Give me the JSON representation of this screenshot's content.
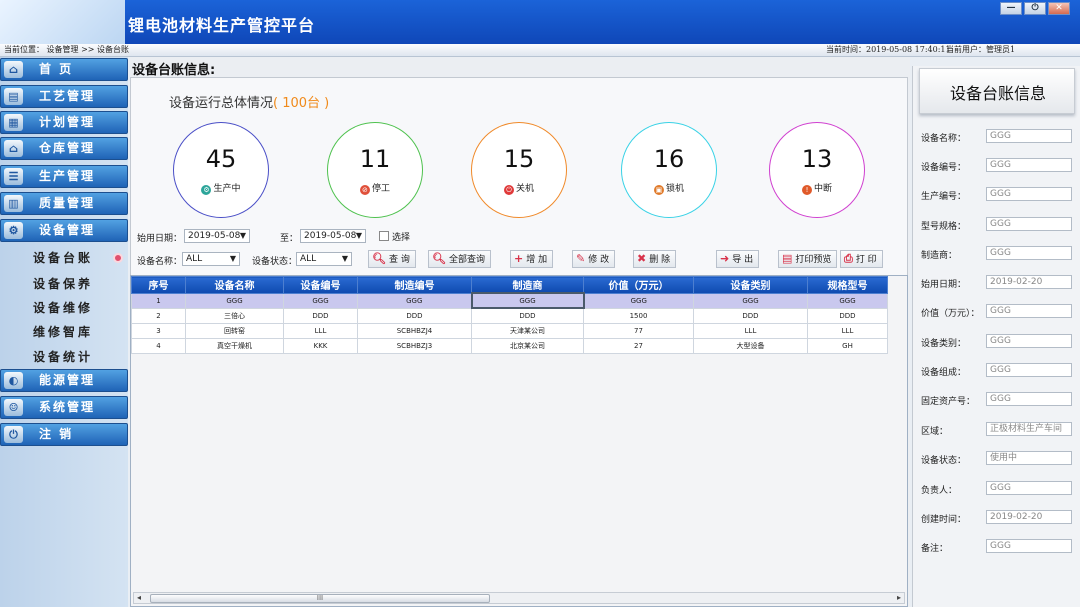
{
  "app": {
    "title": "锂电池材料生产管控平台"
  },
  "window_buttons": {
    "minimize": "—",
    "power": "⏻",
    "close": "✕"
  },
  "status_bar": {
    "location_label": "当前位置：",
    "location_path": "设备管理 >> 设备台账",
    "time_label": "当前时间：",
    "time_value": "2019-05-08 17:40:11",
    "user_label": "当前用户：",
    "user_value": "管理员1"
  },
  "sidebar": {
    "menus": [
      {
        "label": "首 页",
        "icon": "home-icon",
        "glyph": "⌂"
      },
      {
        "label": "工艺管理",
        "icon": "document-icon",
        "glyph": "▤"
      },
      {
        "label": "计划管理",
        "icon": "plan-icon",
        "glyph": "▦"
      },
      {
        "label": "仓库管理",
        "icon": "warehouse-icon",
        "glyph": "⌂"
      },
      {
        "label": "生产管理",
        "icon": "list-icon",
        "glyph": "☰"
      },
      {
        "label": "质量管理",
        "icon": "chart-icon",
        "glyph": "▥"
      },
      {
        "label": "设备管理",
        "icon": "gear-icon",
        "glyph": "⚙"
      },
      {
        "label": "能源管理",
        "icon": "energy-icon",
        "glyph": "◐"
      },
      {
        "label": "系统管理",
        "icon": "users-icon",
        "glyph": "☺"
      },
      {
        "label": "注 销",
        "icon": "power-icon",
        "glyph": "⏻"
      }
    ],
    "sub_items": [
      "设备台账",
      "设备保养",
      "设备维修",
      "维修智库",
      "设备统计"
    ]
  },
  "main": {
    "title": "设备台账信息:",
    "summary_title": "设备运行总体情况",
    "summary_count": "( 100台 )",
    "stats": [
      {
        "value": "45",
        "label": "生产中",
        "color": "#4a4fc7",
        "icon": "running-icon",
        "glyph": "⚙",
        "icon_color": "#2ca59a"
      },
      {
        "value": "11",
        "label": "停工",
        "color": "#4fc24f",
        "icon": "stop-icon",
        "glyph": "⊘",
        "icon_color": "#e0503a"
      },
      {
        "value": "15",
        "label": "关机",
        "color": "#f08a2a",
        "icon": "power-off-icon",
        "glyph": "⏻",
        "icon_color": "#e03a3a"
      },
      {
        "value": "16",
        "label": "锁机",
        "color": "#39d2e6",
        "icon": "lock-icon",
        "glyph": "▣",
        "icon_color": "#e07a2a"
      },
      {
        "value": "13",
        "label": "中断",
        "color": "#d040d0",
        "icon": "warning-icon",
        "glyph": "!",
        "icon_color": "#e05a2a"
      }
    ],
    "filters": {
      "start_date_label": "始用日期：",
      "start_date": "2019-05-08",
      "to_label": "至：",
      "end_date": "2019-05-08",
      "select_label": "选择",
      "device_name_label": "设备名称：",
      "device_name": "ALL",
      "device_status_label": "设备状态：",
      "device_status": "ALL"
    },
    "buttons": {
      "query": "查 询",
      "query_all": "全部查询",
      "add": "增 加",
      "edit": "修 改",
      "delete": "删 除",
      "export": "导 出",
      "print_preview": "打印预览",
      "print": "打 印"
    },
    "table": {
      "columns": [
        "序号",
        "设备名称",
        "设备编号",
        "制造编号",
        "制造商",
        "价值（万元）",
        "设备类别",
        "规格型号"
      ],
      "rows": [
        [
          "1",
          "GGG",
          "GGG",
          "GGG",
          "GGG",
          "GGG",
          "GGG",
          "GGG"
        ],
        [
          "2",
          "三倍心",
          "DDD",
          "DDD",
          "DDD",
          "1500",
          "DDD",
          "DDD"
        ],
        [
          "3",
          "回转窑",
          "LLL",
          "SCBHBZJ4",
          "天津某公司",
          "77",
          "LLL",
          "LLL"
        ],
        [
          "4",
          "真空干燥机",
          "KKK",
          "SCBHBZJ3",
          "北京某公司",
          "27",
          "大型设备",
          "GH"
        ]
      ],
      "scroll_marker": "III"
    }
  },
  "detail_panel": {
    "title": "设备台账信息",
    "fields": [
      {
        "label": "设备名称：",
        "value": "GGG"
      },
      {
        "label": "设备编号：",
        "value": "GGG"
      },
      {
        "label": "生产编号：",
        "value": "GGG"
      },
      {
        "label": "型号规格：",
        "value": "GGG"
      },
      {
        "label": "制造商：",
        "value": "GGG"
      },
      {
        "label": "始用日期：",
        "value": "2019-02-20"
      },
      {
        "label": "价值（万元）：",
        "value": "GGG"
      },
      {
        "label": "设备类别：",
        "value": "GGG"
      },
      {
        "label": "设备组成：",
        "value": "GGG"
      },
      {
        "label": "固定资产号：",
        "value": "GGG"
      },
      {
        "label": "区域：",
        "value": "正极材料生产车间"
      },
      {
        "label": "设备状态：",
        "value": "使用中"
      },
      {
        "label": "负责人：",
        "value": "GGG"
      },
      {
        "label": "创建时间：",
        "value": "2019-02-20"
      },
      {
        "label": "备注：",
        "value": "GGG"
      }
    ]
  }
}
